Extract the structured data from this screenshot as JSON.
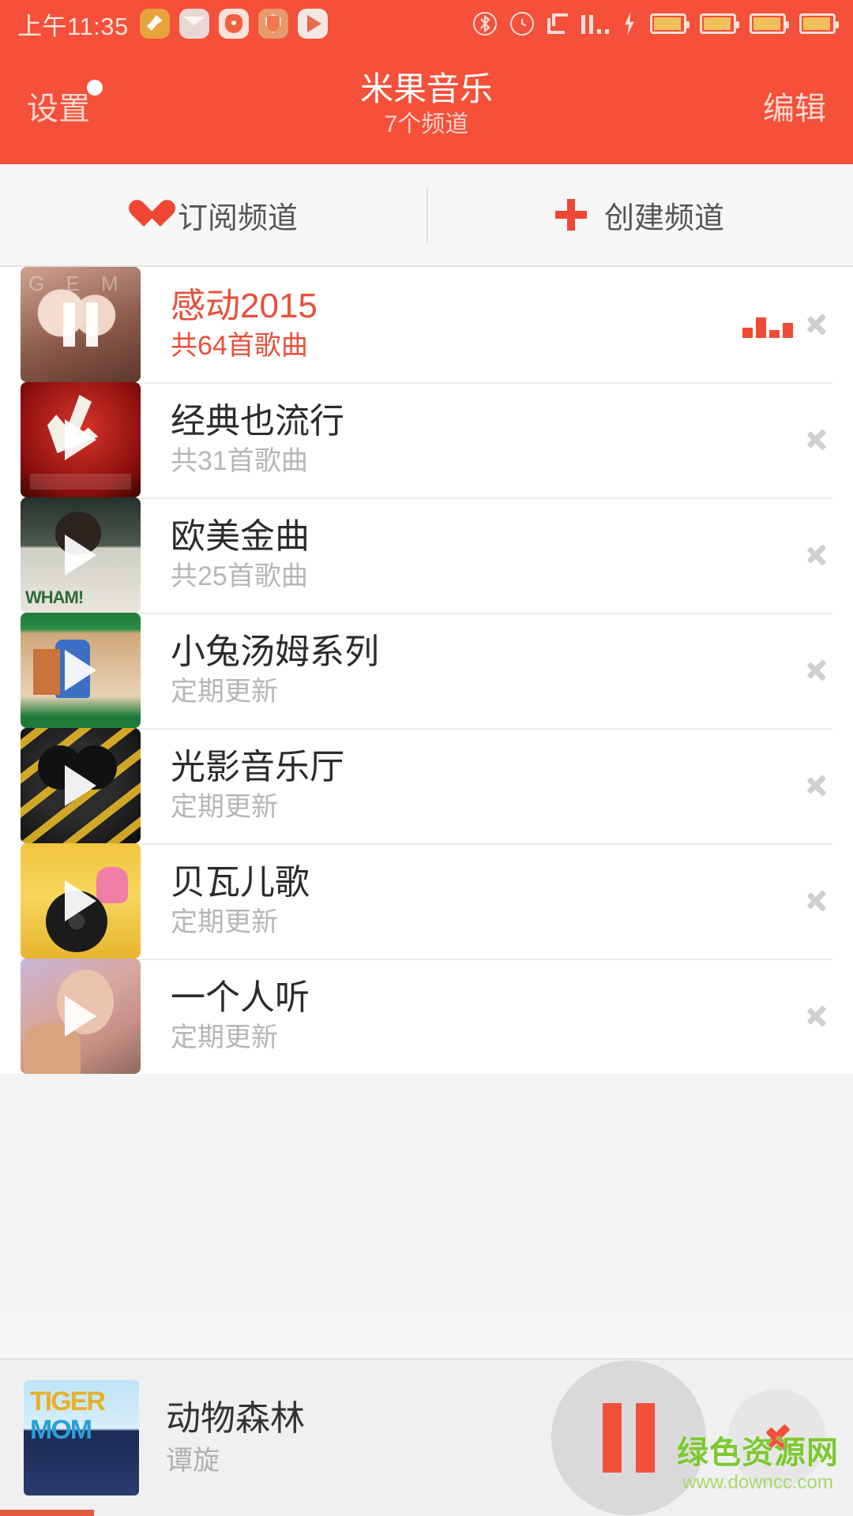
{
  "statusbar": {
    "time": "上午11:35",
    "left_icons": [
      "cleaner-icon",
      "mail-icon",
      "bear-alarm-icon",
      "shield-icon",
      "play-store-icon"
    ],
    "right_icons": [
      "bluetooth-icon",
      "alarm-clock-icon",
      "screenshot-icon",
      "signal-icon",
      "charging-bolt-icon"
    ],
    "battery_count": 4
  },
  "navbar": {
    "left_label": "设置",
    "title": "米果音乐",
    "subtitle": "7个频道",
    "right_label": "编辑",
    "has_badge": true
  },
  "actions": {
    "subscribe_label": "订阅频道",
    "create_label": "创建频道"
  },
  "channels": [
    {
      "title": "感动2015",
      "subtitle": "共64首歌曲",
      "art": "a-gem",
      "state": "playing",
      "overlay": "pause"
    },
    {
      "title": "经典也流行",
      "subtitle": "共31首歌曲",
      "art": "a-voice",
      "state": "idle",
      "overlay": "play"
    },
    {
      "title": "欧美金曲",
      "subtitle": "共25首歌曲",
      "art": "a-wham",
      "state": "idle",
      "overlay": "play"
    },
    {
      "title": "小兔汤姆系列",
      "subtitle": "定期更新",
      "art": "a-tom",
      "state": "idle",
      "overlay": "play"
    },
    {
      "title": "光影音乐厅",
      "subtitle": "定期更新",
      "art": "a-guang",
      "state": "idle",
      "overlay": "play"
    },
    {
      "title": "贝瓦儿歌",
      "subtitle": "定期更新",
      "art": "a-beva",
      "state": "idle",
      "overlay": "play"
    },
    {
      "title": "一个人听",
      "subtitle": "定期更新",
      "art": "a-girl",
      "state": "idle",
      "overlay": "play"
    }
  ],
  "player": {
    "title": "动物森林",
    "artist": "谭旋",
    "art": "a-tiger",
    "pause_icon": "pause-icon",
    "next_icon": "next-icon",
    "progress_percent": 11
  },
  "watermark": {
    "main": "绿色资源网",
    "sub": "www.downcc.com"
  },
  "colors": {
    "brand_red": "#f4503a",
    "accent_red": "#ef4a33",
    "text_dark": "#2b2b2b",
    "text_muted": "#b6b6b6",
    "page_bg": "#f4f4f4"
  }
}
